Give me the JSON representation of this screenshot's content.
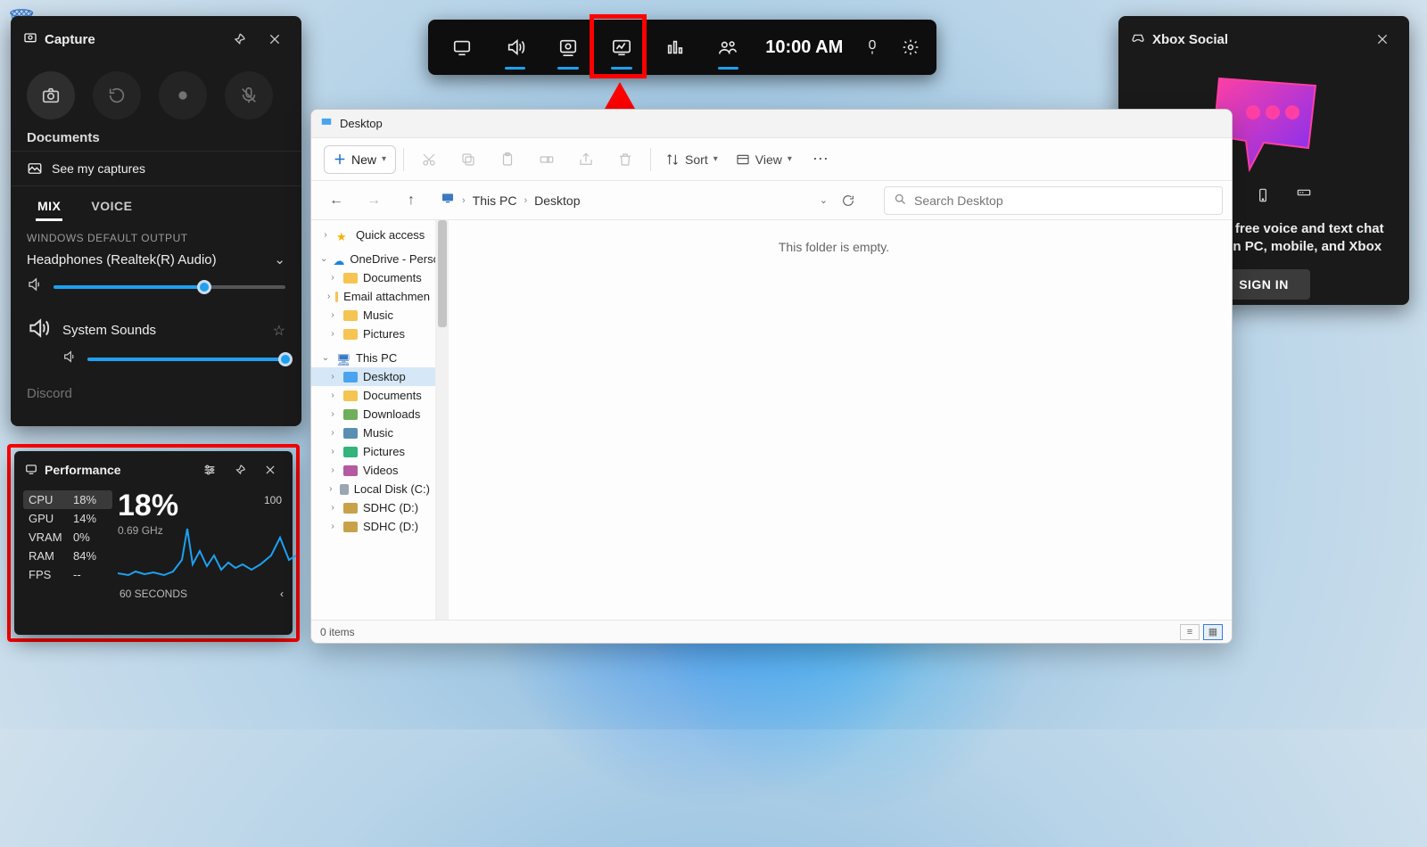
{
  "capture": {
    "title": "Capture",
    "documents_label": "Documents",
    "see_captures": "See my captures",
    "tabs": {
      "mix": "MIX",
      "voice": "VOICE"
    },
    "output_section": "WINDOWS DEFAULT OUTPUT",
    "device": "Headphones (Realtek(R) Audio)",
    "device_volume_pct": 65,
    "system_sounds": "System Sounds",
    "system_volume_pct": 100,
    "truncated_app": "Discord"
  },
  "perf": {
    "title": "Performance",
    "metrics": [
      {
        "label": "CPU",
        "value": "18%"
      },
      {
        "label": "GPU",
        "value": "14%"
      },
      {
        "label": "VRAM",
        "value": "0%"
      },
      {
        "label": "RAM",
        "value": "84%"
      },
      {
        "label": "FPS",
        "value": "--"
      }
    ],
    "big_value": "18%",
    "freq": "0.69 GHz",
    "yaxis_max": "100",
    "time_window": "60 SECONDS"
  },
  "gamebar": {
    "clock": "10:00 AM"
  },
  "social": {
    "title": "Xbox Social",
    "message": "Sign in to use free voice and text chat with friends on PC, mobile, and Xbox",
    "button": "SIGN IN"
  },
  "explorer": {
    "window_title": "Desktop",
    "new_label": "New",
    "sort_label": "Sort",
    "view_label": "View",
    "breadcrumbs": [
      "This PC",
      "Desktop"
    ],
    "search_placeholder": "Search Desktop",
    "empty_message": "This folder is empty.",
    "status": "0 items",
    "tree": {
      "quick_access": "Quick access",
      "onedrive": "OneDrive - Person",
      "onedrive_children": [
        "Documents",
        "Email attachmen",
        "Music",
        "Pictures"
      ],
      "this_pc": "This PC",
      "this_pc_children": [
        {
          "label": "Desktop",
          "icon": "folderb",
          "selected": true
        },
        {
          "label": "Documents",
          "icon": "folder"
        },
        {
          "label": "Downloads",
          "icon": "dl"
        },
        {
          "label": "Music",
          "icon": "mus"
        },
        {
          "label": "Pictures",
          "icon": "pic"
        },
        {
          "label": "Videos",
          "icon": "vid"
        },
        {
          "label": "Local Disk (C:)",
          "icon": "disk"
        },
        {
          "label": "SDHC (D:)",
          "icon": "sd"
        },
        {
          "label": "SDHC (D:)",
          "icon": "sd"
        }
      ]
    }
  }
}
